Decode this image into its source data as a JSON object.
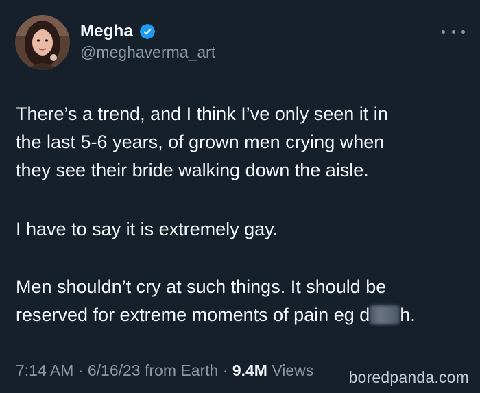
{
  "tweet": {
    "author": {
      "display_name": "Megha",
      "handle": "@meghaverma_art",
      "verified": true,
      "verified_color": "#1d9bf0"
    },
    "more_icon": "more-horizontal-icon",
    "paragraphs": [
      "There’s a trend, and I think I’ve only seen it in\nthe last 5-6 years, of grown men crying when\nthey see their bride walking down the aisle.",
      "I have to say it is extremely gay.",
      "Men shouldn’t cry at such things. It should be"
    ],
    "last_line_prefix": "reserved for extreme moments of pain eg d",
    "last_line_suffix": "h.",
    "meta": {
      "time": "7:14 AM",
      "separator": " · ",
      "date": "6/16/23",
      "source": " from Earth",
      "views_count": "9.4M",
      "views_label": " Views"
    }
  },
  "watermark": "boredpanda.com",
  "colors": {
    "background": "#15202b",
    "text": "#f5f8fa",
    "secondary_text": "#8b98a5"
  }
}
